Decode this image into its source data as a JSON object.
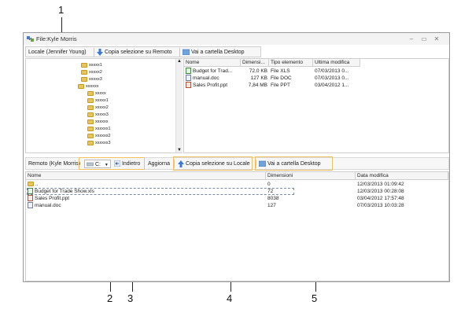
{
  "callouts": [
    "1",
    "2",
    "3",
    "4",
    "5"
  ],
  "window": {
    "title": "File:Kyle Morris",
    "controls": [
      "–",
      "▭",
      "✕"
    ]
  },
  "local_toolbar": {
    "location": "Locale (Jennifer Young)",
    "copy_label": "Copia selezione su Remoto",
    "desktop_label": "Vai a cartella Desktop"
  },
  "local_tree": {
    "items": [
      "xxxxx1",
      "xxxxx2",
      "xxxxx3",
      "xxxxxx",
      "xxxxx",
      "xxxxx1",
      "xxxxx2",
      "xxxxx3",
      "xxxxxx",
      "xxxxxx1",
      "xxxxxx2",
      "xxxxxx3"
    ]
  },
  "local_files": {
    "headers": [
      "Nome",
      "Dimensi...",
      "Tipo elemento",
      "Ultima modifica"
    ],
    "rows": [
      {
        "name": "Budget for Trad...",
        "size": "72,0 KB",
        "type": "File XLS",
        "modified": "07/03/2013 0..."
      },
      {
        "name": "manual.doc",
        "size": "127 KB",
        "type": "File DOC",
        "modified": "07/03/2013 0..."
      },
      {
        "name": "Sales Profit.ppt",
        "size": "7,84 MB",
        "type": "File PPT",
        "modified": "03/04/2012 1..."
      }
    ]
  },
  "remote_toolbar": {
    "location": "Remoto (Kyle Morris)",
    "drive": "C:",
    "back_label": "Indietro",
    "refresh_label": "Aggiorna",
    "copy_label": "Copia selezione su Locale",
    "desktop_label": "Vai a cartella Desktop"
  },
  "remote_files": {
    "headers": [
      "Nome",
      "Dimensioni",
      "Data modifica"
    ],
    "rows": [
      {
        "name": "..",
        "size": "0",
        "modified": "12/03/2013 01:09:42"
      },
      {
        "name": "Budget for Trade Show.xls",
        "size": "72",
        "modified": "12/03/2013 00:28:08"
      },
      {
        "name": "Sales Profit.ppt",
        "size": "8038",
        "modified": "03/04/2012 17:57:48"
      },
      {
        "name": "manual.doc",
        "size": "127",
        "modified": "07/03/2013 10:03:28"
      }
    ]
  }
}
